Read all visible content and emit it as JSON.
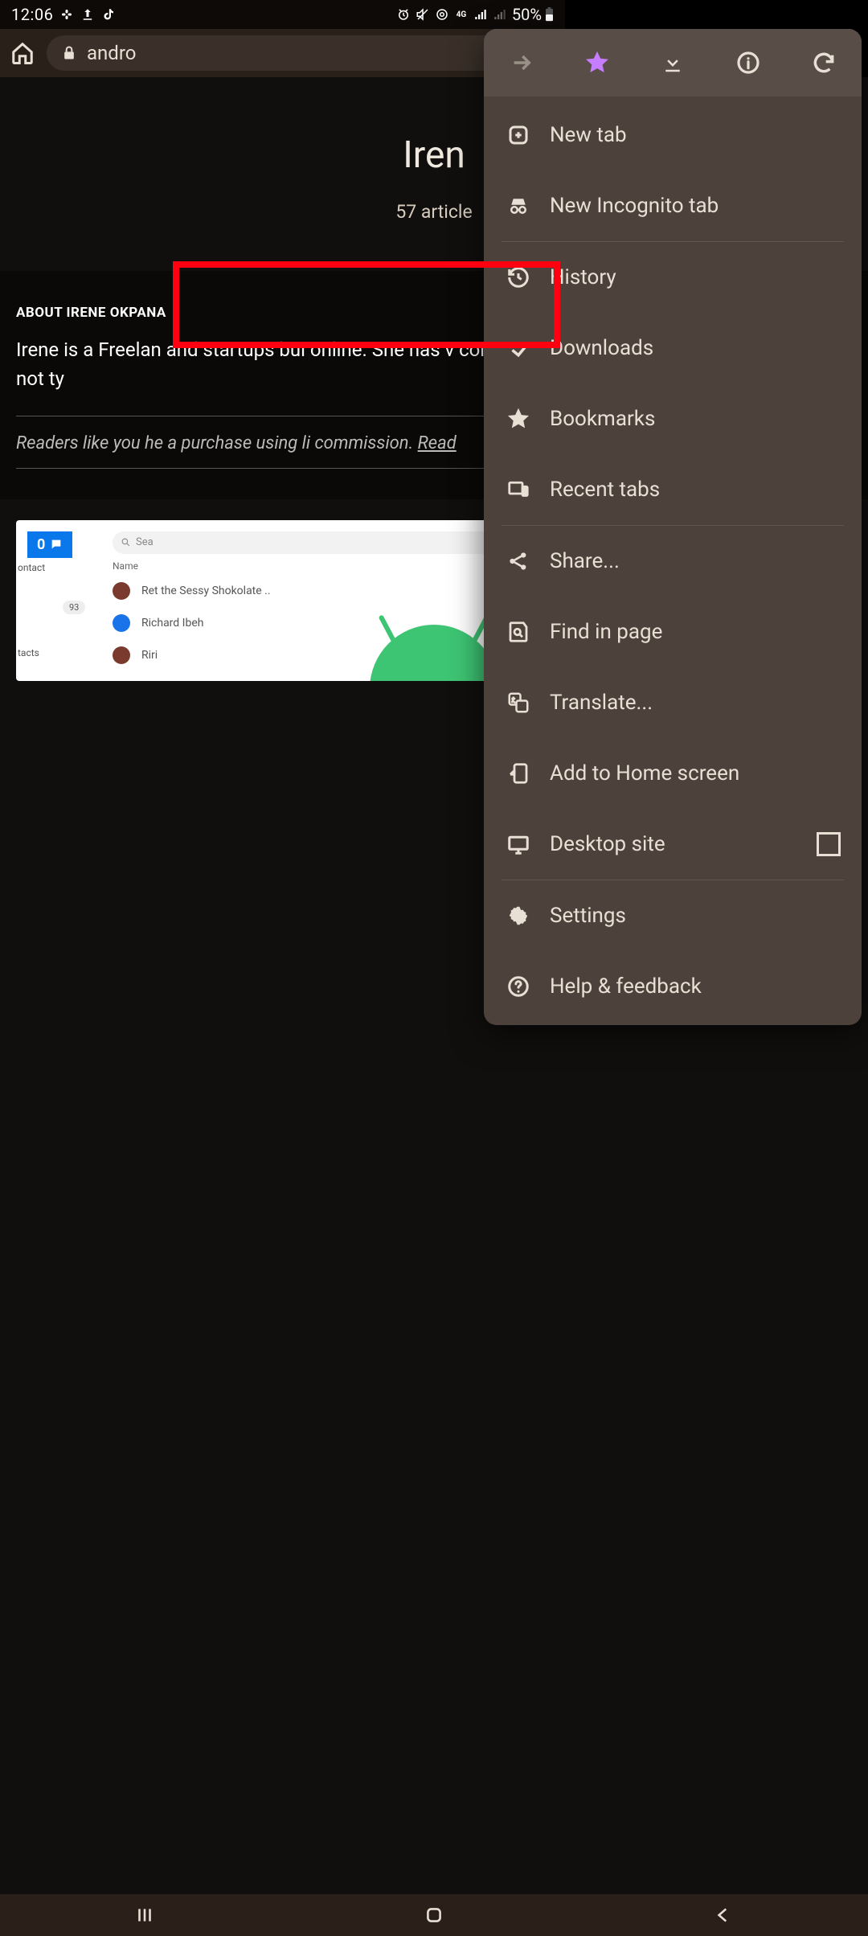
{
  "status": {
    "time": "12:06",
    "battery_pct": "50%"
  },
  "browser": {
    "url_visible": "andro"
  },
  "page": {
    "hero_title": "Iren",
    "hero_sub_prefix": "57 article",
    "about_label": "ABOUT IRENE OKPANA",
    "bio": "Irene is a Freelan and startups bui online. She has v commerce, and experience. She while she's not ty",
    "disclosure": "Readers like you he a purchase using li commission. ",
    "disclosure_link": "Read "
  },
  "card": {
    "badge_count": "0",
    "search_placeholder": "Sea",
    "col_name": "Name",
    "sidebar_contact": "ontact",
    "sidebar_tacts": "tacts",
    "badge_93": "93",
    "row1": "Ret the Sessy Shokolate ..",
    "row2": "Richard Ibeh",
    "row3": "Riri"
  },
  "menu": {
    "new_tab": "New tab",
    "incognito": "New Incognito tab",
    "history": "History",
    "downloads": "Downloads",
    "bookmarks": "Bookmarks",
    "recent_tabs": "Recent tabs",
    "share": "Share...",
    "find": "Find in page",
    "translate": "Translate...",
    "add_home": "Add to Home screen",
    "desktop": "Desktop site",
    "settings": "Settings",
    "help": "Help & feedback"
  }
}
